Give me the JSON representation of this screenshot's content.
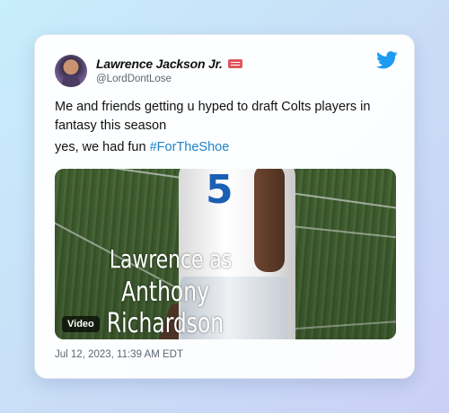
{
  "tweet": {
    "author_name": "Lawrence Jackson Jr.",
    "author_handle": "@LordDontLose",
    "text_line1": "Me and friends getting u hyped to draft Colts players in fantasy this season",
    "text_line2_prefix": "yes, we had fun ",
    "hashtag": "#ForTheShoe",
    "timestamp": "Jul 12, 2023, 11:39 AM EDT",
    "badge_color": "#e0565d"
  },
  "media": {
    "caption_line1": "Lawrence as",
    "caption_line2": "Anthony Richardson",
    "jersey_number": "5",
    "badge_label": "Video"
  },
  "icons": {
    "platform": "twitter-bird-icon"
  },
  "colors": {
    "accent": "#1d9bf0",
    "hashtag": "#1d83c9"
  }
}
